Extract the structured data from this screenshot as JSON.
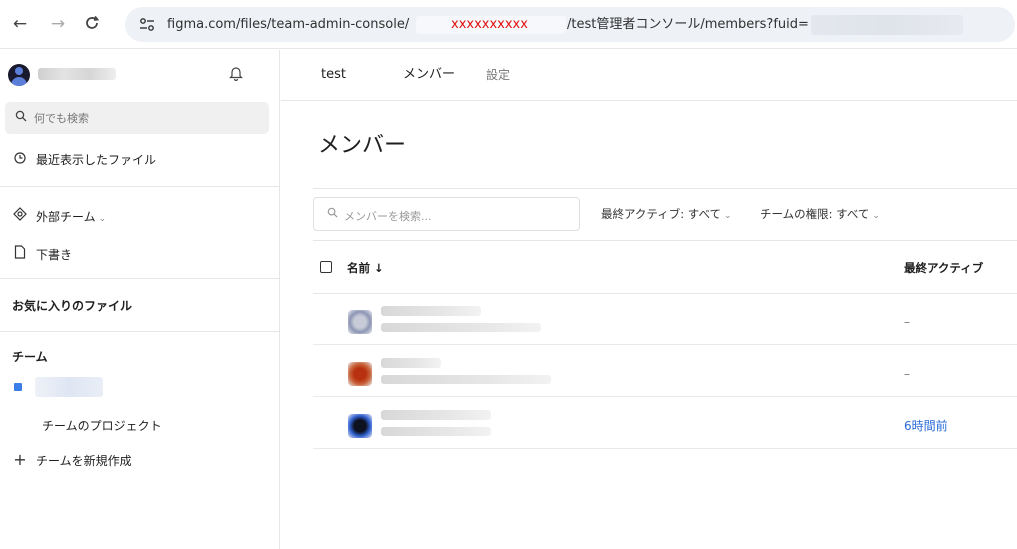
{
  "browser": {
    "back_icon": "←",
    "forward_icon": "→",
    "reload_icon": "C",
    "url_prefix": "figma.com/files/team-admin-console/",
    "url_redacted": "xxxxxxxxxx",
    "url_suffix": "/test管理者コンソール/members?fuid="
  },
  "sidebar": {
    "notification_icon": "bell-icon",
    "search_placeholder": "何でも検索",
    "recent_files": "最近表示したファイル",
    "external_teams": "外部チーム",
    "drafts": "下書き",
    "favorites_heading": "お気に入りのファイル",
    "team_heading": "チーム",
    "team_projects": "チームのプロジェクト",
    "new_team": "チームを新規作成",
    "team_color": "#3b7ee8"
  },
  "topnav": {
    "team_name": "test",
    "tab_members": "メンバー",
    "tab_settings": "設定"
  },
  "main": {
    "title": "メンバー",
    "search_placeholder": "メンバーを検索...",
    "filter_last_active": "最終アクティブ: すべて",
    "filter_team_role": "チームの権限: すべて",
    "col_name": "名前 ↓",
    "col_last_active": "最終アクティブ",
    "accent_color": "#2a6bd8"
  },
  "members": [
    {
      "last_active": "–",
      "avatar_colors": [
        "#8e96b4",
        "#c7cbd8"
      ]
    },
    {
      "last_active": "–",
      "avatar_colors": [
        "#c8643c",
        "#b8320f"
      ]
    },
    {
      "last_active": "6時間前",
      "avatar_colors": [
        "#2f5fcf",
        "#0d1120"
      ]
    }
  ]
}
